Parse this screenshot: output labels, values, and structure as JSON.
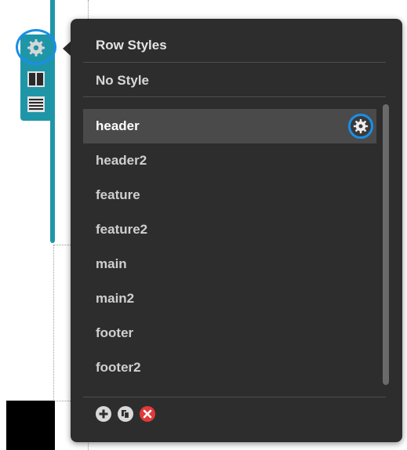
{
  "popup": {
    "title": "Row Styles",
    "no_style_label": "No Style"
  },
  "styles": [
    {
      "name": "header",
      "selected": true
    },
    {
      "name": "header2",
      "selected": false
    },
    {
      "name": "feature",
      "selected": false
    },
    {
      "name": "feature2",
      "selected": false
    },
    {
      "name": "main",
      "selected": false
    },
    {
      "name": "main2",
      "selected": false
    },
    {
      "name": "footer",
      "selected": false
    },
    {
      "name": "footer2",
      "selected": false
    }
  ],
  "icons": {
    "row_settings": "gear-icon",
    "row_columns": "columns-icon",
    "row_drag": "drag-handle-icon",
    "style_settings": "gear-icon",
    "add": "plus-circle-icon",
    "duplicate": "duplicate-icon",
    "delete": "delete-circle-icon"
  },
  "colors": {
    "accent_teal": "#1f96a8",
    "highlight_blue": "#1a8fe6",
    "popup_bg": "#2d2d2d",
    "delete_red": "#e03a3a"
  }
}
